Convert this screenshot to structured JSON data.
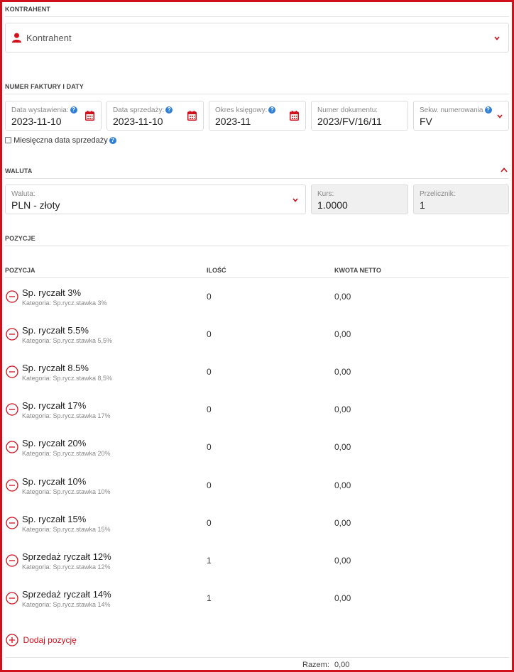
{
  "contractor": {
    "section_title": "KONTRAHENT",
    "placeholder": "Kontrahent"
  },
  "invoice": {
    "section_title": "NUMER FAKTURY I DATY",
    "issue_date": {
      "label": "Data wystawienia:",
      "value": "2023-11-10"
    },
    "sale_date": {
      "label": "Data sprzedaży:",
      "value": "2023-11-10"
    },
    "period": {
      "label": "Okres księgowy:",
      "value": "2023-11"
    },
    "doc_number": {
      "label": "Numer dokumentu:",
      "value": "2023/FV/16/11"
    },
    "sequence": {
      "label": "Sekw. numerowania",
      "value": "FV"
    },
    "monthly_sale_date_label": "Miesięczna data sprzedaży",
    "monthly_sale_date_checked": false
  },
  "currency": {
    "section_title": "WALUTA",
    "currency_field": {
      "label": "Waluta:",
      "value": "PLN - złoty"
    },
    "rate": {
      "label": "Kurs:",
      "value": "1.0000"
    },
    "converter": {
      "label": "Przelicznik:",
      "value": "1"
    }
  },
  "positions": {
    "section_title": "POZYCJE",
    "col_position": "POZYCJA",
    "col_quantity": "ILOŚĆ",
    "col_net": "KWOTA NETTO",
    "rows": [
      {
        "name": "Sp. ryczałt 3%",
        "category": "Kategoria: Sp.rycz.stawka 3%",
        "qty": "0",
        "net": "0,00"
      },
      {
        "name": "Sp. ryczałt 5.5%",
        "category": "Kategoria: Sp.rycz.stawka 5,5%",
        "qty": "0",
        "net": "0,00"
      },
      {
        "name": "Sp. ryczałt 8.5%",
        "category": "Kategoria: Sp.rycz.stawka 8,5%",
        "qty": "0",
        "net": "0,00"
      },
      {
        "name": "Sp. ryczałt 17%",
        "category": "Kategoria: Sp.rycz.stawka 17%",
        "qty": "0",
        "net": "0,00"
      },
      {
        "name": "Sp. ryczałt 20%",
        "category": "Kategoria: Sp.rycz.stawka 20%",
        "qty": "0",
        "net": "0,00"
      },
      {
        "name": "Sp. ryczałt 10%",
        "category": "Kategoria: Sp.rycz.stawka 10%",
        "qty": "0",
        "net": "0,00"
      },
      {
        "name": "Sp. ryczałt 15%",
        "category": "Kategoria: Sp.rycz.stawka 15%",
        "qty": "0",
        "net": "0,00"
      },
      {
        "name": "Sprzedaż ryczałt 12%",
        "category": "Kategoria: Sp.rycz.stawka 12%",
        "qty": "1",
        "net": "0,00"
      },
      {
        "name": "Sprzedaż ryczałt 14%",
        "category": "Kategoria: Sp.rycz.stawka 14%",
        "qty": "1",
        "net": "0,00"
      }
    ],
    "add_label": "Dodaj pozycję",
    "total_label": "Razem:",
    "total_value": "0,00"
  },
  "colors": {
    "accent": "#d0111b",
    "help": "#2f7fd8"
  },
  "icons": [
    "user-icon",
    "chevron-down-icon",
    "calendar-icon",
    "help-icon",
    "chevron-up-icon",
    "remove-circle-icon",
    "add-circle-icon"
  ]
}
